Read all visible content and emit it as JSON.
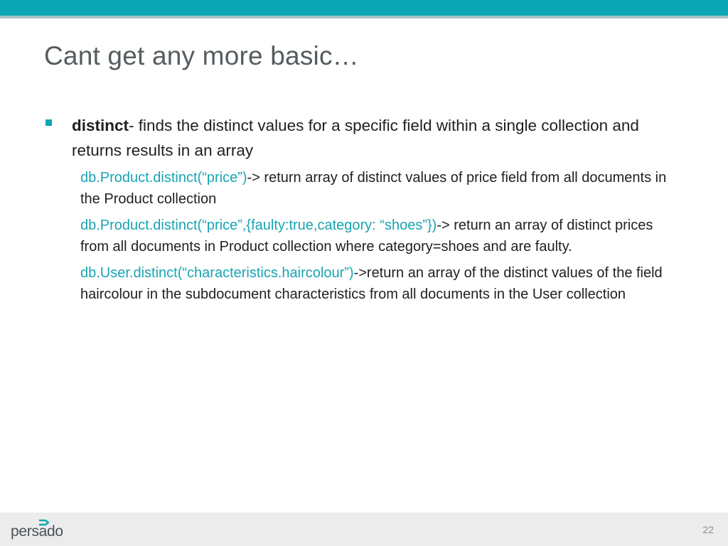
{
  "slide": {
    "title": "Cant get any more basic…",
    "bullet": {
      "term": "distinct",
      "description": "- finds the distinct values for a specific field within a single collection and returns results in an array"
    },
    "sub_items": [
      {
        "code": "db.Product.distinct(“price”)",
        "text": "-> return array of distinct values of   price field from all documents in the Product collection"
      },
      {
        "code": "db.Product.distinct(“price”,{faulty:true,category: “shoes”})",
        "text": "-> return an array of distinct prices from all documents in Product collection where category=shoes and are faulty."
      },
      {
        "code": "db.User.distinct(“characteristics.haircolour”)",
        "text": "->return an array of the distinct values of the field haircolour in the subdocument characteristics from all documents in the User collection"
      }
    ]
  },
  "footer": {
    "logo_text": "persado",
    "page_number": "22"
  },
  "colors": {
    "accent": "#0aa6b4",
    "code": "#18a4b3",
    "title": "#555c5f"
  },
  "icons": {
    "bullet": "square-bullet-icon",
    "logo_mark": "arrow-mark-icon"
  }
}
